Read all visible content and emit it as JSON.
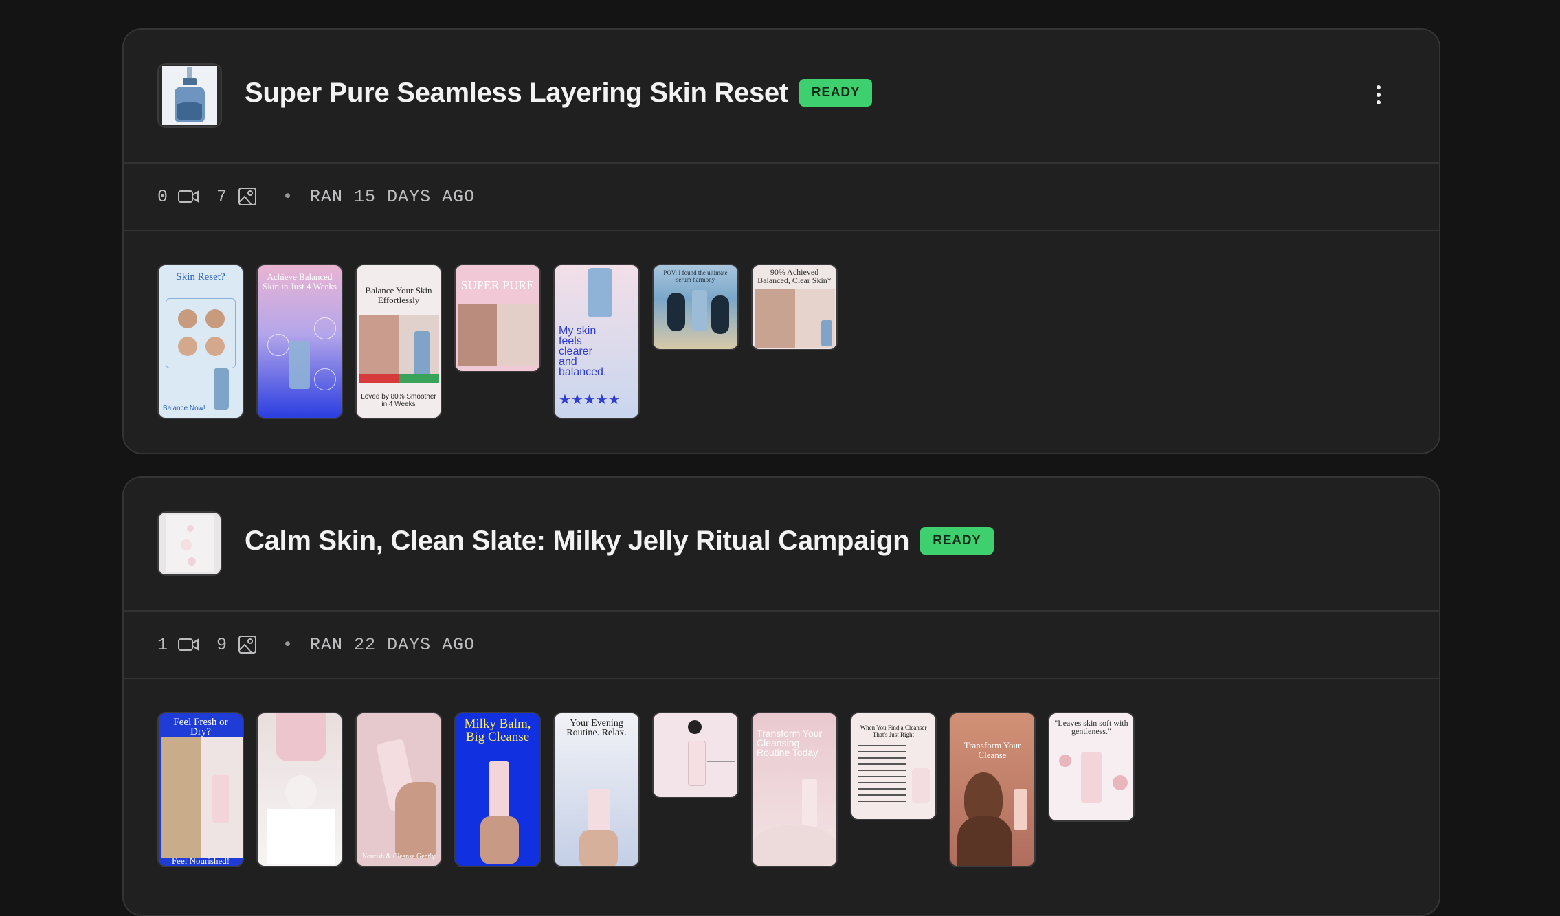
{
  "campaigns": [
    {
      "title": "Super Pure Seamless Layering Skin Reset",
      "status": "READY",
      "videos": "0",
      "images": "7",
      "ran": "RAN 15 DAYS AGO",
      "creatives": [
        {
          "caption": "Skin Reset?",
          "sub": "Balance Now!",
          "bg": "#dbe9f5",
          "fg": "#2b63b5"
        },
        {
          "caption": "Achieve Balanced Skin in Just 4 Weeks",
          "sub": "",
          "bg": "#8b83e8",
          "fg": "#ffffff"
        },
        {
          "caption": "Balance Your Skin Effortlessly",
          "sub": "Loved by 80% Smoother in 4 Weeks",
          "bg": "#f3eced",
          "fg": "#2a2a2a"
        },
        {
          "caption": "SUPER PURE",
          "sub": "",
          "bg": "#f0c8d6",
          "fg": "#ffffff"
        },
        {
          "caption": "My skin feels clearer and balanced.",
          "sub": "★★★★★",
          "bg": "#f2dfe8",
          "fg": "#2f3cc9"
        },
        {
          "caption": "POV: I found the ultimate serum harmony",
          "sub": "",
          "bg": "#7aa7c9",
          "fg": "#1c2b3a"
        },
        {
          "caption": "90% Achieved Balanced, Clear Skin*",
          "sub": "",
          "bg": "#efe6e6",
          "fg": "#333333"
        }
      ]
    },
    {
      "title": "Calm Skin, Clean Slate: Milky Jelly Ritual Campaign",
      "status": "READY",
      "videos": "1",
      "images": "9",
      "ran": "RAN 22 DAYS AGO",
      "creatives": [
        {
          "caption": "Feel Fresh or Dry?",
          "sub": "Feel Nourished!",
          "bg": "#1f3dd6",
          "fg": "#ffffff"
        },
        {
          "caption": "",
          "sub": "",
          "bg": "#e9dede",
          "fg": "#333333"
        },
        {
          "caption": "",
          "sub": "Nourish & Cleanse Gently",
          "bg": "#e6c9cd",
          "fg": "#ffffff"
        },
        {
          "caption": "Milky Balm, Big Cleanse",
          "sub": "",
          "bg": "#1130e0",
          "fg": "#ffef5a"
        },
        {
          "caption": "Your Evening Routine. Relax.",
          "sub": "",
          "bg": "#dde1ee",
          "fg": "#222222"
        },
        {
          "caption": "",
          "sub": "",
          "bg": "#f2e4e8",
          "fg": "#333333"
        },
        {
          "caption": "Transform Your Cleansing Routine Today",
          "sub": "",
          "bg": "#e9c9cf",
          "fg": "#ffffff"
        },
        {
          "caption": "When You Find a Cleanser That's Just Right",
          "sub": "",
          "bg": "#f5eaea",
          "fg": "#222222"
        },
        {
          "caption": "Transform Your Cleanse",
          "sub": "",
          "bg": "#d19176",
          "fg": "#ffffff"
        },
        {
          "caption": "\"Leaves skin soft with gentleness.\"",
          "sub": "",
          "bg": "#f6eef0",
          "fg": "#333333"
        }
      ]
    }
  ]
}
